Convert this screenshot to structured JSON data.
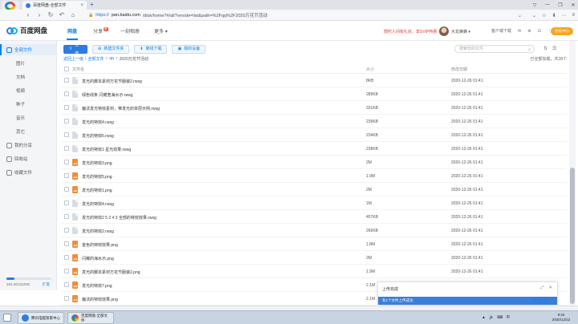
{
  "browser": {
    "app_logo_text": "百度搜索",
    "tab_title": "百度网盘-全部文件",
    "tab_close": "×",
    "new_tab": "+",
    "window_controls": [
      "▽",
      "—",
      "❐",
      "✕"
    ],
    "nav": {
      "back": "‹",
      "forward": "›",
      "refresh": "↻",
      "undo": "↶",
      "home": "⌂"
    },
    "url_scheme": "https://",
    "url_host": "pan.baidu.com",
    "url_path": "/disk/home?#/all?vmode=list&path=%2Fqq%2F2020万花节活动",
    "url_dropdown": "⌄",
    "tools": [
      "⌄",
      "☆",
      "⬇",
      "⋯",
      "≡"
    ]
  },
  "header": {
    "brand": "百度网盘",
    "nav": [
      {
        "label": "网盘",
        "badge": ""
      },
      {
        "label": "分享",
        "badge": "新"
      },
      {
        "label": "一刻相册",
        "badge": ""
      },
      {
        "label": "更多",
        "badge": ""
      }
    ],
    "more_arrow": "▾",
    "promo": "限时人间有礼处，享SVIP特惠",
    "username": "大龙蜂蜂",
    "user_arrow": "▾",
    "tools": [
      "客户端下载",
      "✉",
      "⚙",
      "⊡",
      "⋮"
    ],
    "vip_button": "会员中心"
  },
  "sidebar": {
    "items": [
      {
        "label": "全部文件",
        "active": true,
        "sub": false
      },
      {
        "label": "图片",
        "active": false,
        "sub": true
      },
      {
        "label": "文档",
        "active": false,
        "sub": true
      },
      {
        "label": "视频",
        "active": false,
        "sub": true
      },
      {
        "label": "种子",
        "active": false,
        "sub": true
      },
      {
        "label": "音乐",
        "active": false,
        "sub": true
      },
      {
        "label": "其它",
        "active": false,
        "sub": true
      },
      {
        "label": "我的分享",
        "active": false,
        "sub": false
      },
      {
        "label": "回收站",
        "active": false,
        "sub": false
      },
      {
        "label": "收藏文件",
        "active": false,
        "sub": false
      }
    ],
    "quota_text": "191.2G/1120G",
    "quota_fraction": 0.17,
    "upgrade": "扩容"
  },
  "toolbar": {
    "upload": "上传",
    "new_folder": "新建文件夹",
    "offline_download": "离线下载",
    "my_devices": "我的设备",
    "search_placeholder": "搜索您的文件",
    "view_icons": [
      "⇅",
      "☰"
    ]
  },
  "breadcrumb": {
    "parts": [
      "返回上一级",
      "全部文件",
      "qq",
      "2020万花节活动"
    ],
    "sep": "|",
    "arrow": ">",
    "loaded_info": "已全部加载，共28个"
  },
  "columns": {
    "name": "文件名",
    "size": "大小",
    "date": "修改日期"
  },
  "files": [
    {
      "name": "发光的脚本素材万花节服装2.rwsg",
      "size": "8KB",
      "date": "2020-12-26 01:41",
      "type": "file"
    },
    {
      "name": "绿色线条 闪耀宽海水示.rwsg",
      "size": "289KB",
      "date": "2020-12-26 01:41",
      "type": "file"
    },
    {
      "name": "魔法发光特效素材，带发光的单层示例.rwsg",
      "size": "331KB",
      "date": "2020-12-26 01:41",
      "type": "file"
    },
    {
      "name": "发光的特效4.rwsg",
      "size": "239KB",
      "date": "2020-12-26 01:41",
      "type": "file"
    },
    {
      "name": "发光的特效6.rwsg",
      "size": "234KB",
      "date": "2020-12-26 01:41",
      "type": "file"
    },
    {
      "name": "发光的特效1 星光效果.rwsg",
      "size": "238KB",
      "date": "2020-12-26 01:41",
      "type": "file"
    },
    {
      "name": "发光的特效3.png",
      "size": "2M",
      "date": "2020-12-26 01:41",
      "type": "image"
    },
    {
      "name": "发光的特效5.png",
      "size": "1.9M",
      "date": "2020-12-26 01:41",
      "type": "image"
    },
    {
      "name": "发光的特效1.png",
      "size": "2M",
      "date": "2020-12-26 01:41",
      "type": "image"
    },
    {
      "name": "发光的特效4.rwsg",
      "size": "1M",
      "date": "2020-12-26 01:41",
      "type": "file"
    },
    {
      "name": "发光的特效2 5 2 4 3 全部的特效效果.rwsg",
      "size": "457KB",
      "date": "2020-12-26 01:41",
      "type": "file"
    },
    {
      "name": "发光的特效2.rwsg",
      "size": "266KB",
      "date": "2020-12-26 01:41",
      "type": "file"
    },
    {
      "name": "金色的特效效果.png",
      "size": "1.8M",
      "date": "2020-12-26 01:41",
      "type": "image"
    },
    {
      "name": "闪耀的海水示.png",
      "size": "2M",
      "date": "2020-12-26 01:41",
      "type": "image"
    },
    {
      "name": "发光的脚本素材万花节服装2.png",
      "size": "1.9M",
      "date": "2020-12-26 01:41",
      "type": "image"
    },
    {
      "name": "发光的特效7.png",
      "size": "2.1M",
      "date": "2020-12-26 01:41",
      "type": "image"
    },
    {
      "name": "魔法的特效效果.png",
      "size": "2.1M",
      "date": "2020-12-26 01:41",
      "type": "image"
    }
  ],
  "upload_popup": {
    "title": "上传完成",
    "controls": [
      "⤢",
      "✕"
    ],
    "bar_text": "有1个文件上传成功"
  },
  "watermark": "腾讯号",
  "taskbar": {
    "tasks": [
      "腾讯电脑管家中心",
      "百度网盘-全部文件"
    ],
    "tray": [
      "▲",
      "🔊",
      "⌨",
      "中"
    ],
    "time": "9:34",
    "date": "2020/12/22"
  },
  "colors": {
    "accent": "#2d7be5",
    "promo": "#e23a2d",
    "vip": "#f5a623",
    "image_icon": "#f08c3a"
  }
}
